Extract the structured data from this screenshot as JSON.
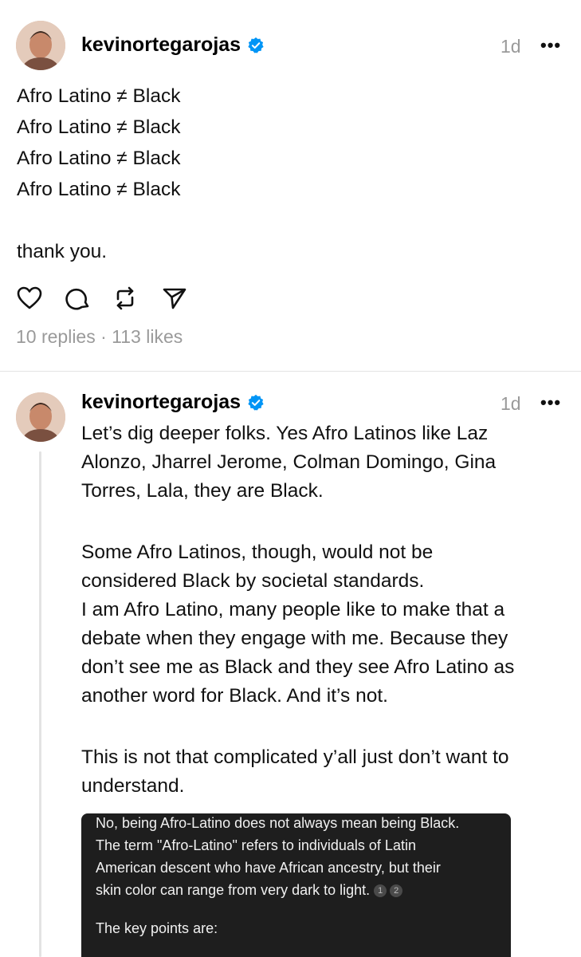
{
  "post1": {
    "username": "kevinortegarojas",
    "time": "1d",
    "more": "•••",
    "lines": [
      "Afro Latino ≠ Black",
      "Afro Latino ≠ Black",
      "Afro Latino ≠ Black",
      "Afro Latino ≠ Black",
      "",
      "thank you."
    ],
    "stats": "10 replies · 113 likes"
  },
  "post2": {
    "username": "kevinortegarojas",
    "time": "1d",
    "more": "•••",
    "lines": [
      "Let’s dig deeper folks. Yes Afro Latinos like Laz",
      "Alonzo, Jharrel Jerome, Colman Domingo, Gina",
      "Torres, Lala, they are Black.",
      "Some Afro Latinos, though, would not be",
      "considered Black by societal standards.",
      "I am Afro Latino, many people like to make that a",
      "debate when they engage with me. Because they",
      "don’t see me as Black and they see Afro Latino as",
      "another word for Black. And it’s not.",
      "This is not that complicated y’all just don’t want to",
      "understand."
    ]
  },
  "screenshot": {
    "lines": [
      "No, being Afro-Latino does not always mean being Black.",
      "The term \"Afro-Latino\" refers to individuals of Latin",
      "American descent who have African ancestry, but their",
      "skin color can range from very dark to light.",
      "The key points are:"
    ],
    "citations": [
      "1",
      "2"
    ]
  },
  "icons": {
    "like": "heart-icon",
    "reply": "comment-icon",
    "repost": "repost-icon",
    "share": "send-icon",
    "verified": "verified-badge-icon"
  },
  "colors": {
    "verified": "#0095f6",
    "muted": "#9a9a9a",
    "divider": "#e3e3e3"
  }
}
